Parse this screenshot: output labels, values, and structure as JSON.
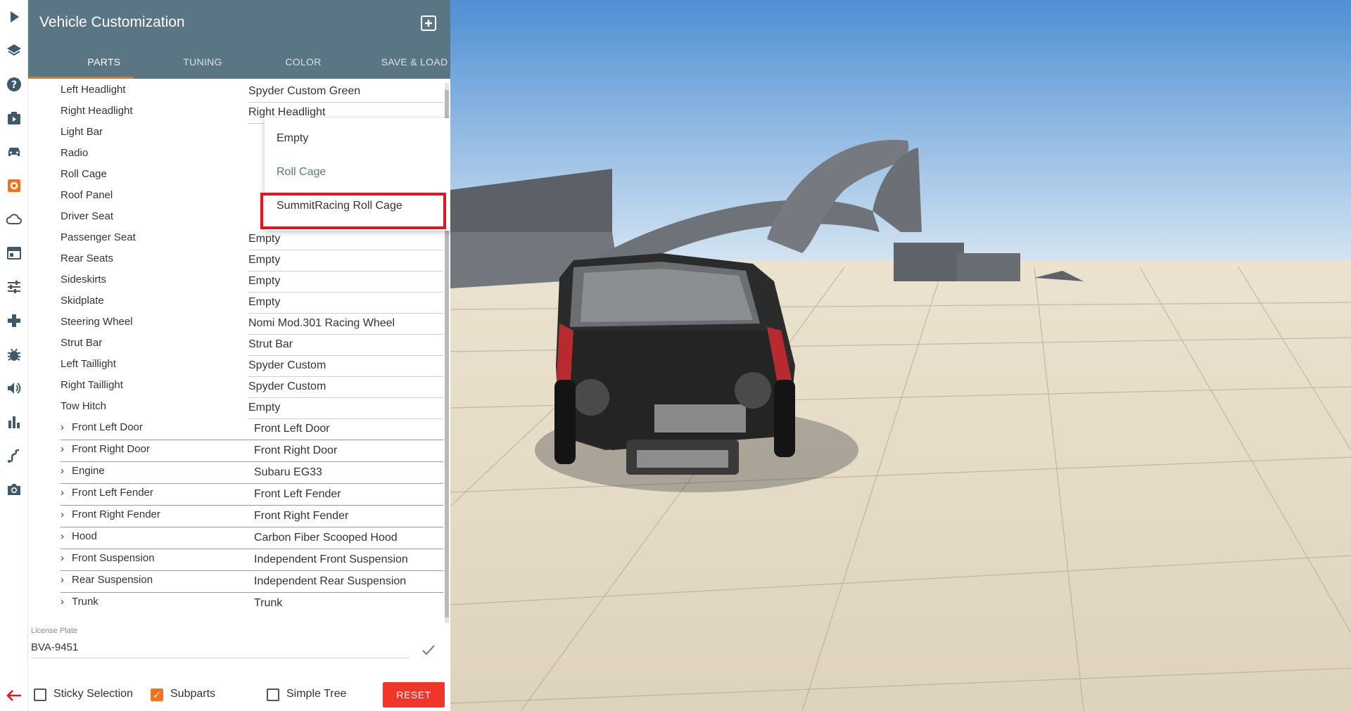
{
  "panel": {
    "title": "Vehicle Customization",
    "tabs": [
      "PARTS",
      "TUNING",
      "COLOR",
      "SAVE & LOAD"
    ],
    "active_tab": "PARTS"
  },
  "parts": [
    {
      "label": "Left Headlight",
      "value": "Spyder Custom Green"
    },
    {
      "label": "Right Headlight",
      "value": "Right Headlight"
    },
    {
      "label": "Light Bar",
      "value": ""
    },
    {
      "label": "Radio",
      "value": ""
    },
    {
      "label": "Roll Cage",
      "value": ""
    },
    {
      "label": "Roof Panel",
      "value": ""
    },
    {
      "label": "Driver Seat",
      "value": ""
    },
    {
      "label": "Passenger Seat",
      "value": "Empty"
    },
    {
      "label": "Rear Seats",
      "value": "Empty"
    },
    {
      "label": "Sideskirts",
      "value": "Empty"
    },
    {
      "label": "Skidplate",
      "value": "Empty"
    },
    {
      "label": "Steering Wheel",
      "value": "Nomi Mod.301 Racing Wheel"
    },
    {
      "label": "Strut Bar",
      "value": "Strut Bar"
    },
    {
      "label": "Left Taillight",
      "value": "Spyder Custom"
    },
    {
      "label": "Right Taillight",
      "value": "Spyder Custom"
    },
    {
      "label": "Tow Hitch",
      "value": "Empty"
    }
  ],
  "subparts": [
    {
      "label": "Front Left Door",
      "value": "Front Left Door"
    },
    {
      "label": "Front Right Door",
      "value": "Front Right Door"
    },
    {
      "label": "Engine",
      "value": "Subaru EG33"
    },
    {
      "label": "Front Left Fender",
      "value": "Front Left Fender"
    },
    {
      "label": "Front Right Fender",
      "value": "Front Right Fender"
    },
    {
      "label": "Hood",
      "value": "Carbon Fiber Scooped Hood"
    },
    {
      "label": "Front Suspension",
      "value": "Independent Front Suspension"
    },
    {
      "label": "Rear Suspension",
      "value": "Independent Rear Suspension"
    },
    {
      "label": "Trunk",
      "value": "Trunk"
    }
  ],
  "dropdown": {
    "options": [
      "Empty",
      "Roll Cage",
      "SummitRacing Roll Cage"
    ],
    "current": "Roll Cage",
    "highlighted": "SummitRacing Roll Cage"
  },
  "license_plate": {
    "label": "License Plate",
    "value": "BVA-9451"
  },
  "footer": {
    "sticky_selection": {
      "label": "Sticky Selection",
      "checked": false
    },
    "subparts": {
      "label": "Subparts",
      "checked": true
    },
    "simple_tree": {
      "label": "Simple Tree",
      "checked": false
    },
    "reset_label": "RESET"
  },
  "rail_icons": [
    "play-icon",
    "layers-icon",
    "help-icon",
    "scenario-icon",
    "car-icon",
    "vehicle-config-icon",
    "cloud-icon",
    "window-icon",
    "sliders-icon",
    "gamepad-icon",
    "bug-icon",
    "sound-icon",
    "stats-icon",
    "path-icon",
    "camera-icon"
  ],
  "colors": {
    "header": "#5a7583",
    "accent": "#f0731d",
    "highlight": "#e2151f",
    "reset": "#f0362b"
  }
}
